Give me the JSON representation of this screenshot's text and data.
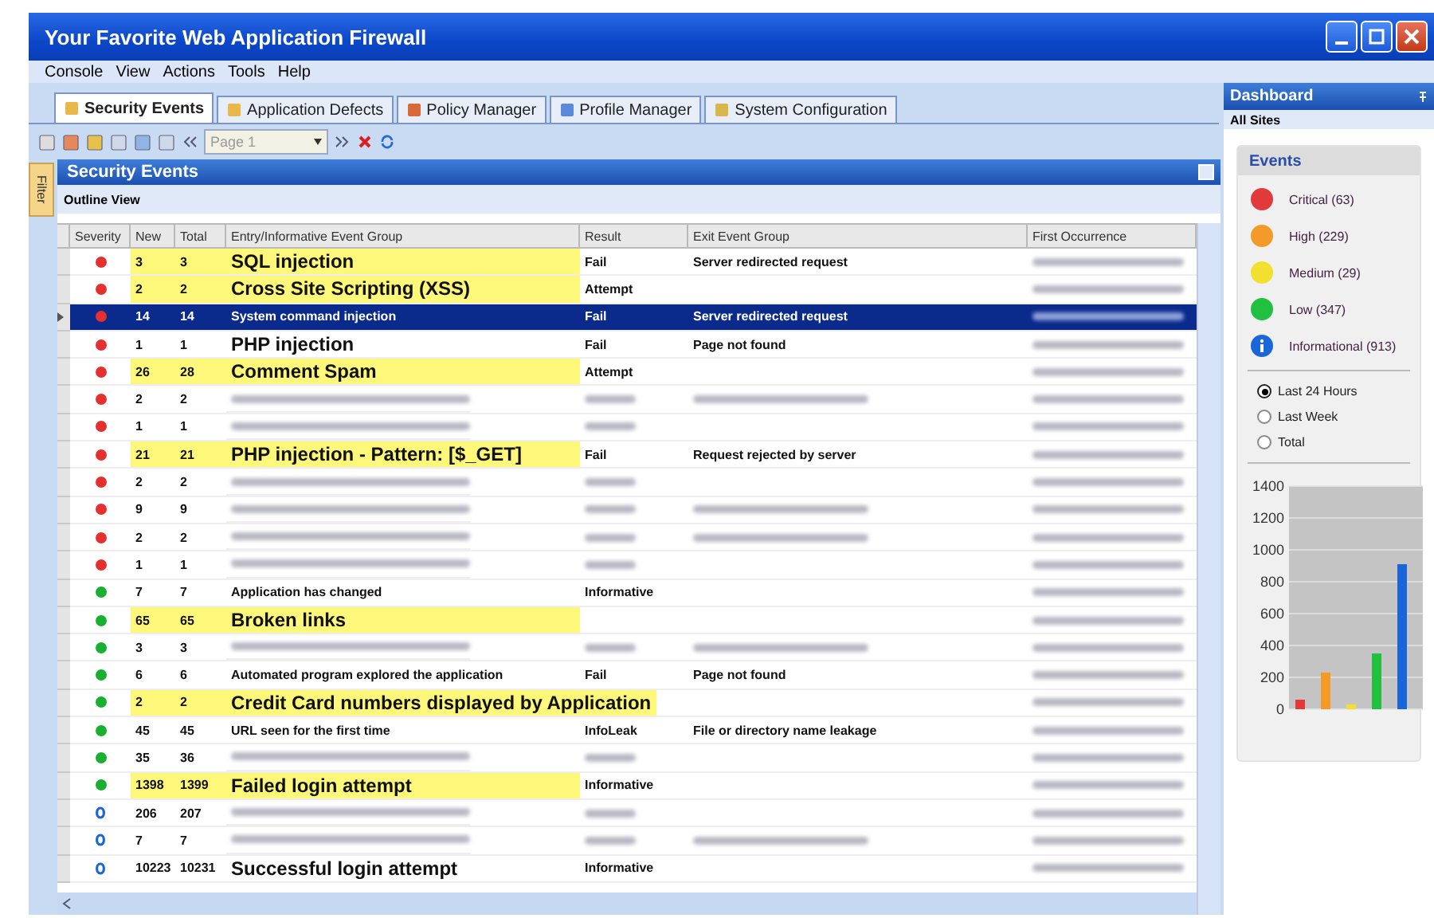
{
  "window": {
    "title": "Your Favorite Web Application Firewall"
  },
  "menu": [
    "Console",
    "View",
    "Actions",
    "Tools",
    "Help"
  ],
  "tabs": [
    {
      "label": "Security Events",
      "selected": true
    },
    {
      "label": "Application Defects",
      "selected": false
    },
    {
      "label": "Policy Manager",
      "selected": false
    },
    {
      "label": "Profile Manager",
      "selected": false
    },
    {
      "label": "System Configuration",
      "selected": false
    }
  ],
  "toolbar": {
    "page_field": "Page 1"
  },
  "panel": {
    "title": "Security Events",
    "filter_tab": "Filter",
    "view": "Outline View"
  },
  "table": {
    "columns": [
      "Severity",
      "New",
      "Total",
      "Entry/Informative Event Group",
      "Result",
      "Exit Event Group",
      "First Occurrence"
    ],
    "rows": [
      {
        "kind": "dot",
        "color": "#e53030",
        "new": "3",
        "total": "3",
        "entry": "SQL injection",
        "result": "Fail",
        "exit": "Server redirected request",
        "highlight": true,
        "large": true,
        "selected": false
      },
      {
        "kind": "dot",
        "color": "#e53030",
        "new": "2",
        "total": "2",
        "entry": "Cross Site Scripting (XSS)",
        "result": "Attempt",
        "highlight": true,
        "large": true,
        "selected": false
      },
      {
        "kind": "dot",
        "color": "#e53030",
        "new": "14",
        "total": "14",
        "entry": "System command injection",
        "result": "Fail",
        "exit": "Server redirected request",
        "highlight": false,
        "large": false,
        "selected": true
      },
      {
        "kind": "dot",
        "color": "#e53030",
        "new": "1",
        "total": "1",
        "entry": "PHP injection",
        "result": "Fail",
        "exit": "Page not found",
        "highlight": false,
        "large": true,
        "selected": false
      },
      {
        "kind": "dot",
        "color": "#e53030",
        "new": "26",
        "total": "28",
        "entry": "Comment Spam",
        "result": "Attempt",
        "highlight": true,
        "large": true,
        "selected": false
      },
      {
        "kind": "dot",
        "color": "#e53030",
        "new": "2",
        "total": "2",
        "highlight": false,
        "selected": false,
        "blurred_entry": true,
        "blurred_result": true,
        "blurred_exit": true
      },
      {
        "kind": "dot",
        "color": "#e53030",
        "new": "1",
        "total": "1",
        "highlight": false,
        "selected": false,
        "blurred_entry": true,
        "blurred_result": true
      },
      {
        "kind": "dot",
        "color": "#e53030",
        "new": "21",
        "total": "21",
        "entry": "PHP injection - Pattern: [$_GET]",
        "result": "Fail",
        "exit": "Request rejected by server",
        "highlight": true,
        "large": true,
        "selected": false
      },
      {
        "kind": "dot",
        "color": "#e53030",
        "new": "2",
        "total": "2",
        "highlight": false,
        "selected": false,
        "blurred_entry": true,
        "blurred_result": true
      },
      {
        "kind": "dot",
        "color": "#e53030",
        "new": "9",
        "total": "9",
        "highlight": false,
        "selected": false,
        "blurred_entry": true,
        "blurred_result": true,
        "blurred_exit": true
      },
      {
        "kind": "dot",
        "color": "#e53030",
        "new": "2",
        "total": "2",
        "highlight": false,
        "selected": false,
        "blurred_entry": true,
        "blurred_result": true,
        "blurred_exit": true
      },
      {
        "kind": "dot",
        "color": "#e53030",
        "new": "1",
        "total": "1",
        "highlight": false,
        "selected": false,
        "blurred_entry": true,
        "blurred_result": true
      },
      {
        "kind": "dot",
        "color": "#18b030",
        "new": "7",
        "total": "7",
        "entry": "Application has changed",
        "result": "Informative",
        "highlight": false,
        "large": false,
        "selected": false
      },
      {
        "kind": "dot",
        "color": "#18b030",
        "new": "65",
        "total": "65",
        "entry": "Broken links",
        "highlight": true,
        "large": true,
        "selected": false
      },
      {
        "kind": "dot",
        "color": "#18b030",
        "new": "3",
        "total": "3",
        "highlight": false,
        "selected": false,
        "blurred_entry": true,
        "blurred_result": true,
        "blurred_exit": true
      },
      {
        "kind": "dot",
        "color": "#18b030",
        "new": "6",
        "total": "6",
        "entry": "Automated program explored the application",
        "result": "Fail",
        "exit": "Page not found",
        "highlight": false,
        "large": false,
        "selected": false
      },
      {
        "kind": "dot",
        "color": "#18b030",
        "new": "2",
        "total": "2",
        "entry": "Credit Card numbers displayed by Application",
        "highlight": true,
        "large": true,
        "selected": false
      },
      {
        "kind": "dot",
        "color": "#18b030",
        "new": "45",
        "total": "45",
        "entry": "URL seen for the first time",
        "result": "InfoLeak",
        "exit": "File or directory name leakage",
        "highlight": false,
        "large": false,
        "selected": false
      },
      {
        "kind": "dot",
        "color": "#18b030",
        "new": "35",
        "total": "36",
        "highlight": false,
        "selected": false,
        "blurred_entry": true,
        "blurred_result": true
      },
      {
        "kind": "dot",
        "color": "#18b030",
        "new": "1398",
        "total": "1399",
        "entry": "Failed login attempt",
        "result": "Informative",
        "highlight": true,
        "large": true,
        "selected": false
      },
      {
        "kind": "info",
        "color": "#1a66d8",
        "new": "206",
        "total": "207",
        "highlight": false,
        "selected": false,
        "blurred_entry": true,
        "blurred_result": true
      },
      {
        "kind": "info",
        "color": "#1a66d8",
        "new": "7",
        "total": "7",
        "highlight": false,
        "selected": false,
        "blurred_entry": true,
        "blurred_result": true,
        "blurred_exit": true
      },
      {
        "kind": "info",
        "color": "#1a66d8",
        "new": "10223",
        "total": "10231",
        "entry": "Successful login attempt",
        "result": "Informative",
        "highlight": false,
        "large": true,
        "selected": false
      }
    ]
  },
  "dashboard": {
    "title": "Dashboard",
    "scope": "All Sites",
    "section": "Events",
    "legend": [
      {
        "kind": "dot",
        "label": "Critical (63)",
        "color": "#e03a3a"
      },
      {
        "kind": "dot",
        "label": "High (229)",
        "color": "#f39a2a"
      },
      {
        "kind": "dot",
        "label": "Medium (29)",
        "color": "#f2e030"
      },
      {
        "kind": "dot",
        "label": "Low (347)",
        "color": "#22c040"
      },
      {
        "kind": "info",
        "label": "Informational (913)",
        "color": "#1a66d8"
      }
    ],
    "ranges": [
      {
        "label": "Last 24 Hours",
        "selected": true
      },
      {
        "label": "Last Week",
        "selected": false
      },
      {
        "label": "Total",
        "selected": false
      }
    ],
    "chart_data": {
      "type": "bar",
      "grid": true,
      "ylim": [
        0,
        1400
      ],
      "yticks": [
        0,
        200,
        400,
        600,
        800,
        1000,
        1200,
        1400
      ],
      "series": [
        {
          "color": "#e03a3a",
          "values": [
            60
          ]
        },
        {
          "color": "#f39a2a",
          "values": [
            230
          ]
        },
        {
          "color": "#f2e030",
          "values": [
            30
          ]
        },
        {
          "color": "#22c040",
          "values": [
            350
          ]
        },
        {
          "color": "#1a66d8",
          "values": [
            910
          ]
        }
      ]
    }
  }
}
